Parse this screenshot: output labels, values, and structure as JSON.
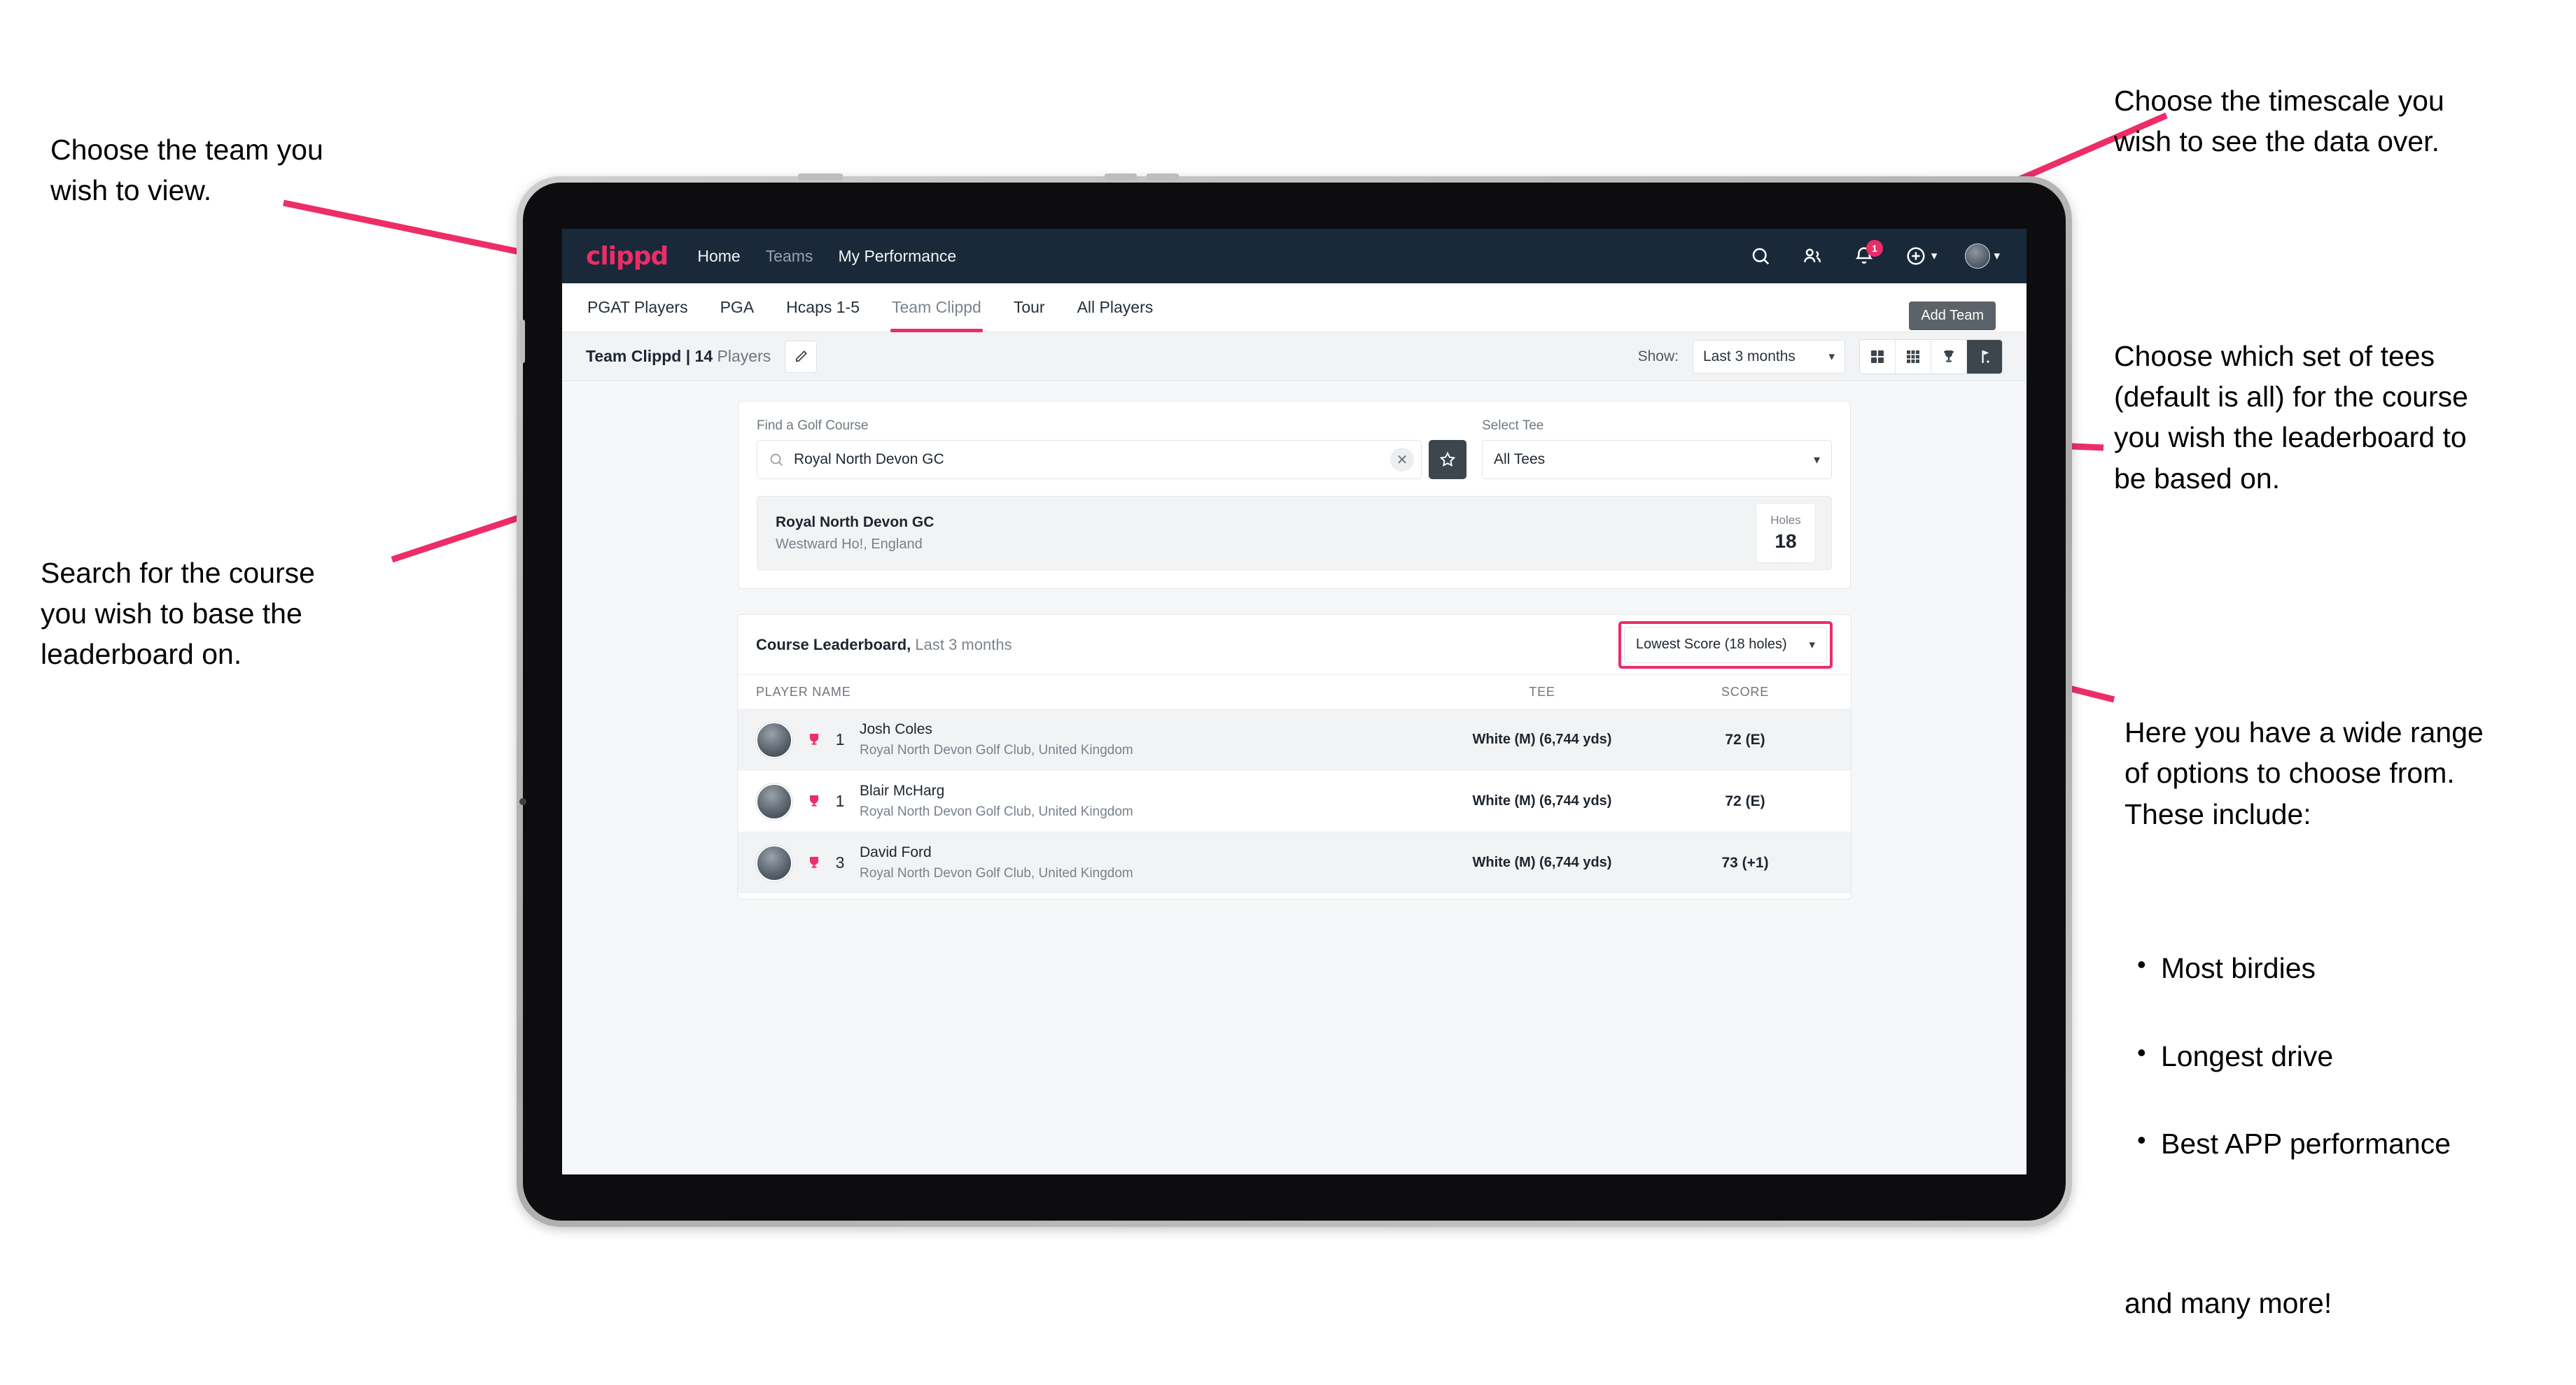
{
  "annotations": {
    "team": "Choose the team you\nwish to view.",
    "timescale": "Choose the timescale you\nwish to see the data over.",
    "tees": "Choose which set of tees\n(default is all) for the course\nyou wish the leaderboard to\nbe based on.",
    "search": "Search for the course\nyou wish to base the\nleaderboard on.",
    "options_intro": "Here you have a wide range\nof options to choose from.\nThese include:",
    "options_list": [
      "Most birdies",
      "Longest drive",
      "Best APP performance"
    ],
    "options_outro": "and many more!"
  },
  "app": {
    "brand": "clippd",
    "nav_links": [
      {
        "label": "Home",
        "muted": false
      },
      {
        "label": "Teams",
        "muted": true
      },
      {
        "label": "My Performance",
        "muted": false
      }
    ],
    "icons": {
      "search": "search-icon",
      "people": "people-icon",
      "bell": "notifications-bell-icon",
      "bell_badge": "1",
      "plus": "add-circle-icon",
      "avatar": "user-avatar"
    },
    "tabs": [
      {
        "label": "PGAT Players",
        "active": false,
        "muted": false
      },
      {
        "label": "PGA",
        "active": false,
        "muted": false
      },
      {
        "label": "Hcaps 1-5",
        "active": false,
        "muted": false
      },
      {
        "label": "Team Clippd",
        "active": true,
        "muted": true
      },
      {
        "label": "Tour",
        "active": false,
        "muted": false
      },
      {
        "label": "All Players",
        "active": false,
        "muted": false
      }
    ],
    "tooltip_add_team": "Add Team",
    "toolbar": {
      "team_name": "Team Clippd | ",
      "player_count": "14",
      "players_word": " Players",
      "edit_icon": "pencil-edit-icon",
      "show_label": "Show:",
      "show_value": "Last 3 months",
      "views": [
        {
          "name": "grid-2x2-view-icon",
          "active": false
        },
        {
          "name": "grid-3x3-view-icon",
          "active": false
        },
        {
          "name": "trophy-view-icon",
          "active": false
        },
        {
          "name": "golf-flag-view-icon",
          "active": true
        }
      ]
    },
    "search_panel": {
      "course_label": "Find a Golf Course",
      "course_value": "Royal North Devon GC",
      "course_placeholder": "Find a Golf Course",
      "clear_icon": "clear-x-icon",
      "star_icon": "favourite-star-icon",
      "tee_label": "Select Tee",
      "tee_value": "All Tees"
    },
    "course_result": {
      "name": "Royal North Devon GC",
      "location": "Westward Ho!, England",
      "holes_label": "Holes",
      "holes_value": "18"
    },
    "leaderboard": {
      "title_bold": "Course Leaderboard,",
      "title_light": " Last 3 months",
      "metric_value": "Lowest Score (18 holes)",
      "columns": {
        "player": "PLAYER NAME",
        "tee": "TEE",
        "score": "SCORE"
      },
      "rows": [
        {
          "rank": "1",
          "name": "Josh Coles",
          "club": "Royal North Devon Golf Club, United Kingdom",
          "tee": "White (M) (6,744 yds)",
          "score": "72 (E)"
        },
        {
          "rank": "1",
          "name": "Blair McHarg",
          "club": "Royal North Devon Golf Club, United Kingdom",
          "tee": "White (M) (6,744 yds)",
          "score": "72 (E)"
        },
        {
          "rank": "3",
          "name": "David Ford",
          "club": "Royal North Devon Golf Club, United Kingdom",
          "tee": "White (M) (6,744 yds)",
          "score": "73 (+1)"
        }
      ]
    }
  },
  "colors": {
    "accent_pink": "#ec2d68",
    "nav_dark": "#19293a",
    "dark_button": "#3d454d"
  }
}
